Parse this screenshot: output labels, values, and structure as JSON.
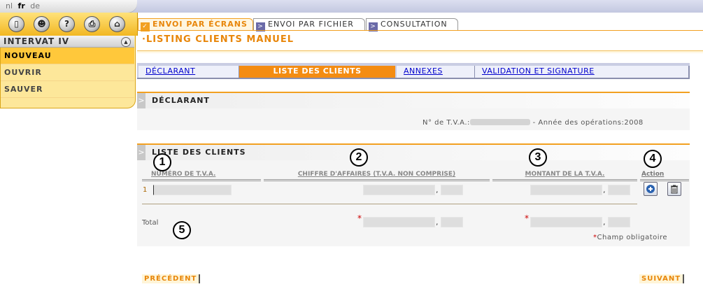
{
  "languages": [
    {
      "code": "nl",
      "selected": false
    },
    {
      "code": "fr",
      "selected": true
    },
    {
      "code": "de",
      "selected": false
    }
  ],
  "toolbar_icons": [
    "exit-icon",
    "user-icon",
    "help-icon",
    "print-icon",
    "home-icon"
  ],
  "menu": {
    "title": "INTERVAT IV",
    "items": [
      {
        "label": "NOUVEAU",
        "active": true
      },
      {
        "label": "OUVRIR",
        "active": false
      },
      {
        "label": "SAUVER",
        "active": false
      }
    ]
  },
  "top_tabs": [
    {
      "label": "ENVOI PAR ÉCRANS",
      "active": true
    },
    {
      "label": "ENVOI PAR FICHIER",
      "active": false
    },
    {
      "label": "CONSULTATION",
      "active": false
    }
  ],
  "page_title": "·LISTING CLIENTS MANUEL",
  "sub_tabs": [
    {
      "label": "DÉCLARANT",
      "active": false
    },
    {
      "label": "LISTE DES CLIENTS",
      "active": true
    },
    {
      "label": "ANNEXES",
      "active": false
    },
    {
      "label": "VALIDATION ET SIGNATURE",
      "active": false
    }
  ],
  "declarant": {
    "title": "DÉCLARANT",
    "vat_label": "N° de T.V.A.:",
    "year_text": "- Année des opérations:2008"
  },
  "clients": {
    "title": "LISTE DES CLIENTS",
    "columns": {
      "vat": "NUMÉRO DE T.V.A.",
      "turnover": "CHIFFRE D'AFFAIRES (T.V.A. NON COMPRISE)",
      "vat_amount": "MONTANT DE LA T.V.A.",
      "action": "Action"
    },
    "row_number": "1",
    "total_label": "Total",
    "required_marker": "*",
    "required_note": "Champ obligatoire",
    "decimal_sep": ","
  },
  "callouts": [
    "1",
    "2",
    "3",
    "4",
    "5"
  ],
  "nav": {
    "prev": "PRÉCÉDENT",
    "next": "SUIVANT"
  }
}
